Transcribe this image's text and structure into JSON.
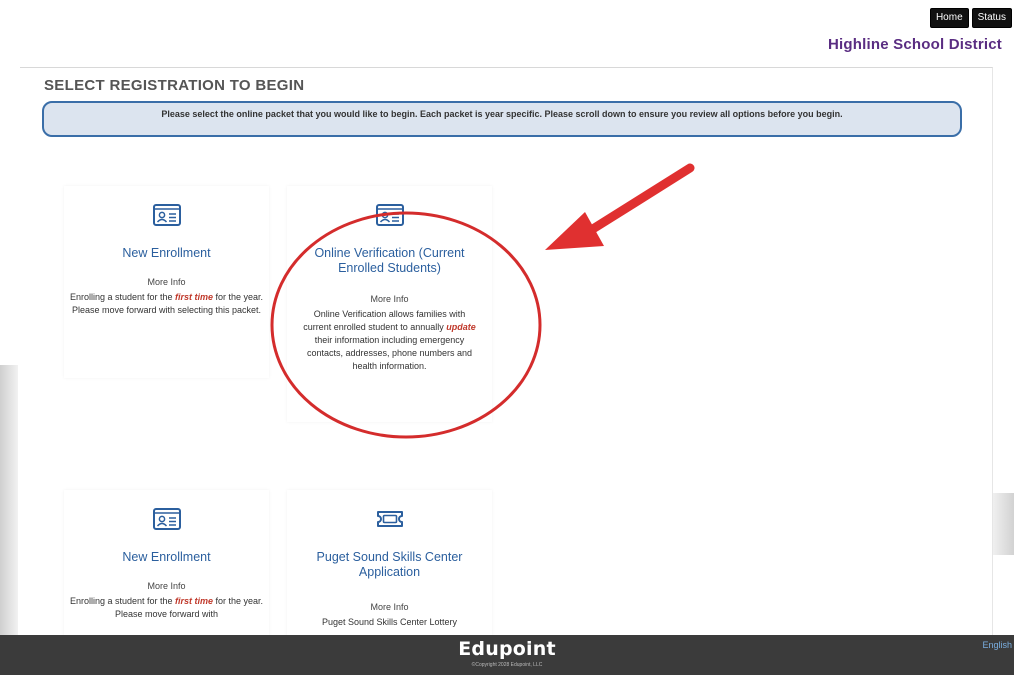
{
  "nav": {
    "home": "Home",
    "status": "Status"
  },
  "district_name": "Highline School District",
  "section_title": "SELECT REGISTRATION TO BEGIN",
  "notice": "Please select the online packet that you would like to begin. Each packet is year specific. Please scroll down to ensure you review all options before you begin.",
  "cards": [
    {
      "title": "New Enrollment",
      "more_info": "More Info",
      "desc_pre": "Enrolling a student for the ",
      "desc_em": "first time",
      "desc_post": " for the year. Please move forward with selecting this packet.",
      "icon": "id-card-icon"
    },
    {
      "title": "Online Verification (Current Enrolled Students)",
      "more_info": "More Info",
      "desc_pre": "Online Verification allows families with current enrolled student to annually ",
      "desc_em": "update",
      "desc_post": " their information including emergency contacts, addresses, phone numbers and health information.",
      "icon": "id-card-icon"
    },
    {
      "title": "New Enrollment",
      "more_info": "More Info",
      "desc_pre": "Enrolling a student for the ",
      "desc_em": "first time",
      "desc_post": " for the year. Please move forward with",
      "icon": "id-card-icon"
    },
    {
      "title": "Puget Sound Skills Center Application",
      "more_info": "More Info",
      "desc_pre": "Puget Sound Skills Center Lottery",
      "desc_em": "",
      "desc_post": "",
      "icon": "ticket-icon"
    }
  ],
  "footer": {
    "brand": "Edupoint",
    "copyright": "©Copyright 2028 Edupoint, LLC",
    "language": "English"
  },
  "colors": {
    "accent": "#2b5f9e",
    "district": "#5a2d82",
    "annotation": "#e03030",
    "notice_border": "#3a6ea8"
  }
}
